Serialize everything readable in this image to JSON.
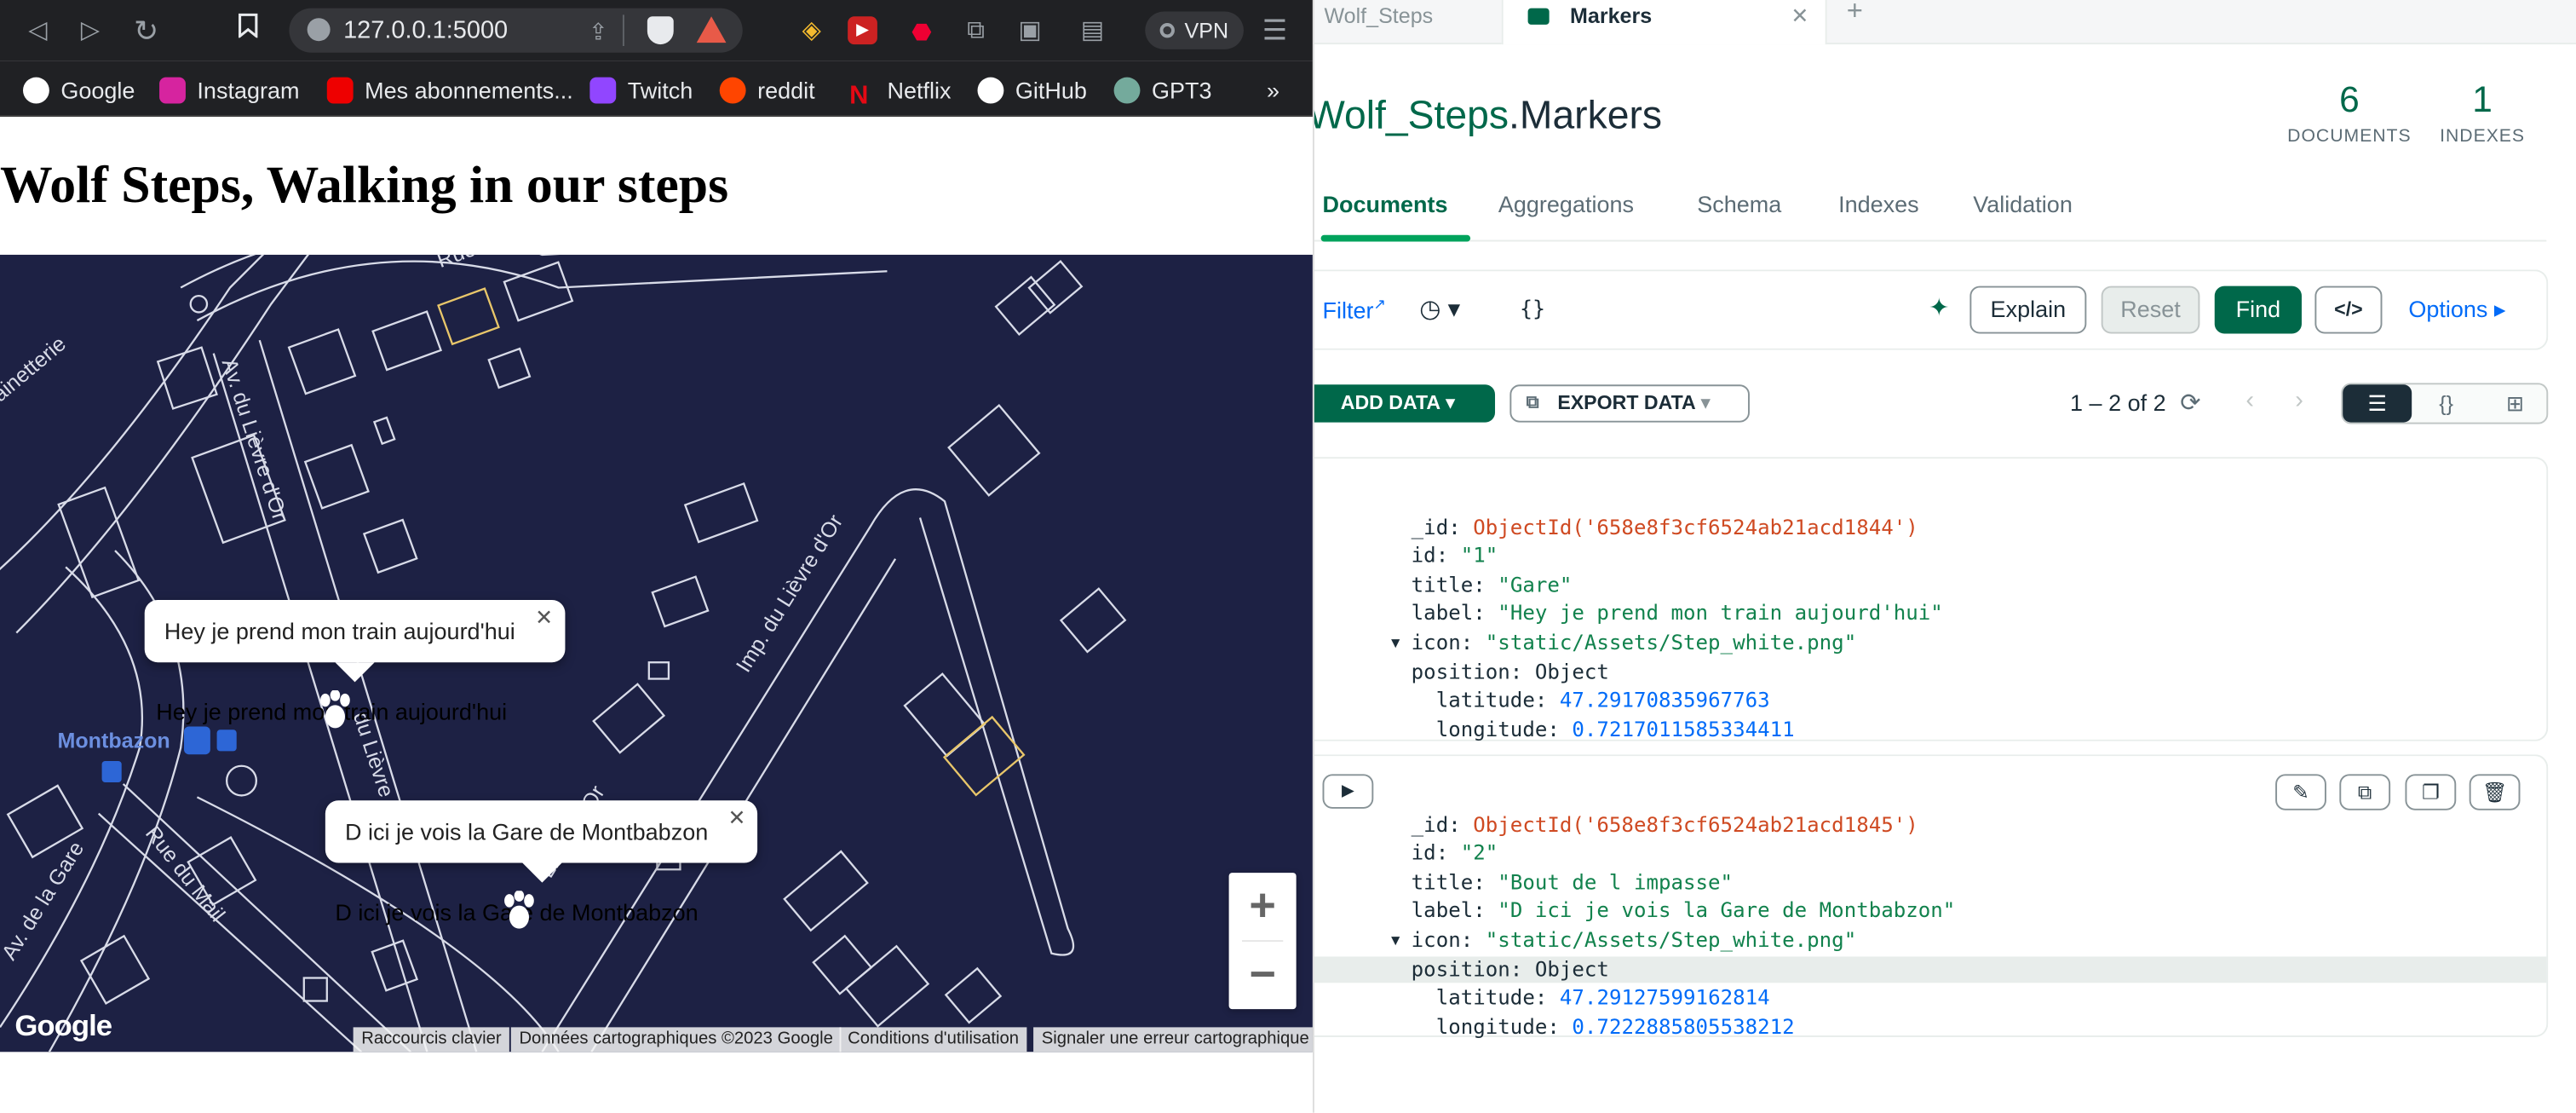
{
  "browser": {
    "url": "127.0.0.1:5000",
    "vpn_label": "VPN",
    "bookmarks": [
      "Google",
      "Instagram",
      "Mes abonnements...",
      "Twitch",
      "reddit",
      "Netflix",
      "GitHub",
      "GPT3"
    ],
    "more": "»"
  },
  "page": {
    "title": "Wolf Steps, Walking in our steps"
  },
  "map": {
    "streets": [
      "Rue",
      "ainetterie",
      "Av. du Lièvre d'Or",
      "Imp. du Lièvre d'Or",
      "Av. de la Gare",
      "Rue du Mail",
      "du Lièvre d'Or",
      "Lièvre d'Or"
    ],
    "place": "Montbazon",
    "markers": [
      {
        "info": "Hey je prend mon train aujourd'hui",
        "label": "Hey je prend mon train aujourd'hui"
      },
      {
        "info": "D ici je vois la Gare de Montbabzon",
        "label": "D ici je vois la Gare de Montbabzon"
      }
    ],
    "close": "✕",
    "zoom_in": "+",
    "zoom_out": "−",
    "logo": "Google",
    "attributions": [
      "Raccourcis clavier",
      "Données cartographiques ©2023 Google",
      "Conditions d'utilisation",
      "Signaler une erreur cartographique"
    ]
  },
  "compass": {
    "tabs": [
      "Wolf_Steps",
      "Markers"
    ],
    "tab_close": "✕",
    "add_tab": "+",
    "db": "Wolf_Steps",
    "coll": ".Markers",
    "stats": [
      {
        "value": "6",
        "label": "DOCUMENTS"
      },
      {
        "value": "1",
        "label": "INDEXES"
      }
    ],
    "subtabs": [
      "Documents",
      "Aggregations",
      "Schema",
      "Indexes",
      "Validation"
    ],
    "filter_label": "Filter",
    "filter_value": "{}",
    "explain": "Explain",
    "reset": "Reset",
    "find": "Find",
    "code_btn": "</>",
    "options": "Options",
    "add_data": "ADD DATA",
    "export_data": "EXPORT DATA",
    "pagination": "1 – 2 of 2",
    "view_icons": [
      "☰",
      "{}",
      "⊞"
    ],
    "documents": [
      {
        "_id": "ObjectId('658e8f3cf6524ab21acd1844')",
        "id": "\"1\"",
        "title": "\"Gare\"",
        "label": "\"Hey je prend mon train aujourd'hui\"",
        "icon": "\"static/Assets/Step_white.png\"",
        "position": "Object",
        "latitude": "47.29170835967763",
        "longitude": "0.7217011585334411"
      },
      {
        "_id": "ObjectId('658e8f3cf6524ab21acd1845')",
        "id": "\"2\"",
        "title": "\"Bout de l impasse\"",
        "label": "\"D ici je vois la Gare de Montbabzon\"",
        "icon": "\"static/Assets/Step_white.png\"",
        "position": "Object",
        "latitude": "47.29127599162814",
        "longitude": "0.7222885805538212"
      }
    ],
    "keys": {
      "_id": "_id",
      "id": "id",
      "title": "title",
      "label": "label",
      "icon": "icon",
      "position": "position",
      "latitude": "latitude",
      "longitude": "longitude"
    }
  }
}
